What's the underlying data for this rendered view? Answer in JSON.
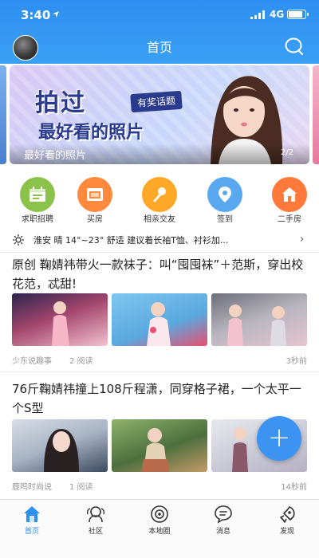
{
  "status_bar": {
    "time": "3:40",
    "network": "4G"
  },
  "header": {
    "title": "首页"
  },
  "banner": {
    "heading": "拍过",
    "tag": "有奖话题",
    "subheading": "最好看的照片",
    "caption": "最好看的照片",
    "index": "2/2"
  },
  "categories": [
    {
      "label": "求职招聘",
      "icon": "calendar-icon",
      "color": "#8bc34a"
    },
    {
      "label": "买房",
      "icon": "house-sign-icon",
      "color": "#ff8a3d"
    },
    {
      "label": "相亲交友",
      "icon": "microphone-icon",
      "color": "#ffa726"
    },
    {
      "label": "签到",
      "icon": "location-pin-icon",
      "color": "#5aa9f0"
    },
    {
      "label": "二手房",
      "icon": "house-icon",
      "color": "#ff7a3a"
    }
  ],
  "weather": {
    "text": "淮安  晴  14°~23°  舒适  建议着长袖T恤、衬衫加..."
  },
  "articles": [
    {
      "title": "原创 鞠婧祎带火一款袜子：叫“囤囤袜”＋范斯，穿出校花范，忒甜!",
      "source": "少东说趣事",
      "reads": "2 阅读",
      "time": "3秒前"
    },
    {
      "title": "76斤鞠婧祎撞上108斤程潇，同穿格子裙，一个太平一个S型",
      "source": "鹿鸣时尚说",
      "reads": "1 阅读",
      "time": "14秒前"
    }
  ],
  "fab": {
    "label": "+"
  },
  "tabbar": [
    {
      "label": "首页",
      "icon": "home-icon",
      "active": true
    },
    {
      "label": "社区",
      "icon": "community-icon",
      "active": false
    },
    {
      "label": "本地圈",
      "icon": "local-circle-icon",
      "active": false
    },
    {
      "label": "消息",
      "icon": "message-icon",
      "active": false
    },
    {
      "label": "发现",
      "icon": "discover-icon",
      "active": false
    }
  ],
  "colors": {
    "primary": "#2d8ff0",
    "fab": "#3d93f2",
    "text": "#222222",
    "meta": "#999999"
  }
}
